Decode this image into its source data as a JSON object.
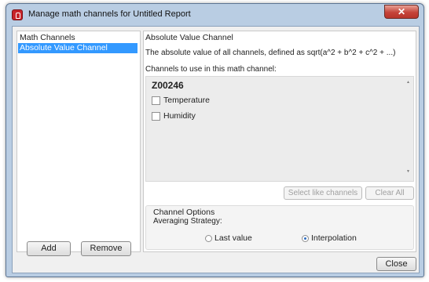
{
  "window": {
    "title": "Manage math channels for Untitled Report",
    "close_glyph": "✕"
  },
  "left": {
    "header": "Math Channels",
    "items": [
      "Absolute Value Channel"
    ],
    "add_label": "Add",
    "remove_label": "Remove"
  },
  "right": {
    "title": "Absolute Value Channel",
    "description": "The absolute value of all channels, defined as sqrt(a^2 + b^2 + c^2 + ...)",
    "channels_label": "Channels to use in this math channel:",
    "group": "Z00246",
    "channels": [
      {
        "label": "Temperature",
        "checked": false
      },
      {
        "label": "Humidity",
        "checked": false
      }
    ],
    "select_like_label": "Select like channels",
    "clear_all_label": "Clear All",
    "options_title": "Channel Options",
    "averaging_label": "Averaging Strategy:",
    "radio_last": "Last value",
    "radio_interp": "Interpolation",
    "selected_strategy": "Interpolation"
  },
  "footer": {
    "close_label": "Close"
  }
}
